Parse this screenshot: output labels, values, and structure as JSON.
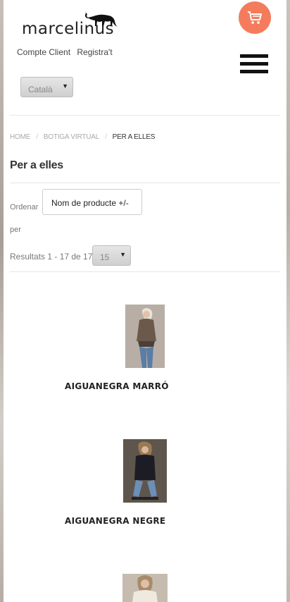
{
  "header": {
    "logo_text": "marcelinus",
    "account_link": "Compte Client",
    "register_link": "Registra't",
    "language": "Català"
  },
  "breadcrumb": {
    "home": "HOME",
    "section": "BOTIGA VIRTUAL",
    "current": "PER A ELLES"
  },
  "page_title": "Per a elles",
  "sort": {
    "label": "Ordenar per",
    "value": "Nom de producte +/-"
  },
  "results": {
    "text": "Resultats 1 - 17 de 17",
    "per_page": "15"
  },
  "products": [
    {
      "name": "AIGUANEGRA MARRÓ"
    },
    {
      "name": "AIGUANEGRA NEGRE"
    },
    {
      "name": ""
    }
  ],
  "colors": {
    "cart_accent": "#f47c5c",
    "menu_bars": "#111111"
  },
  "icons": [
    "cat-logo-icon",
    "cart-icon",
    "hamburger-menu-icon",
    "dropdown-arrow-icon"
  ]
}
